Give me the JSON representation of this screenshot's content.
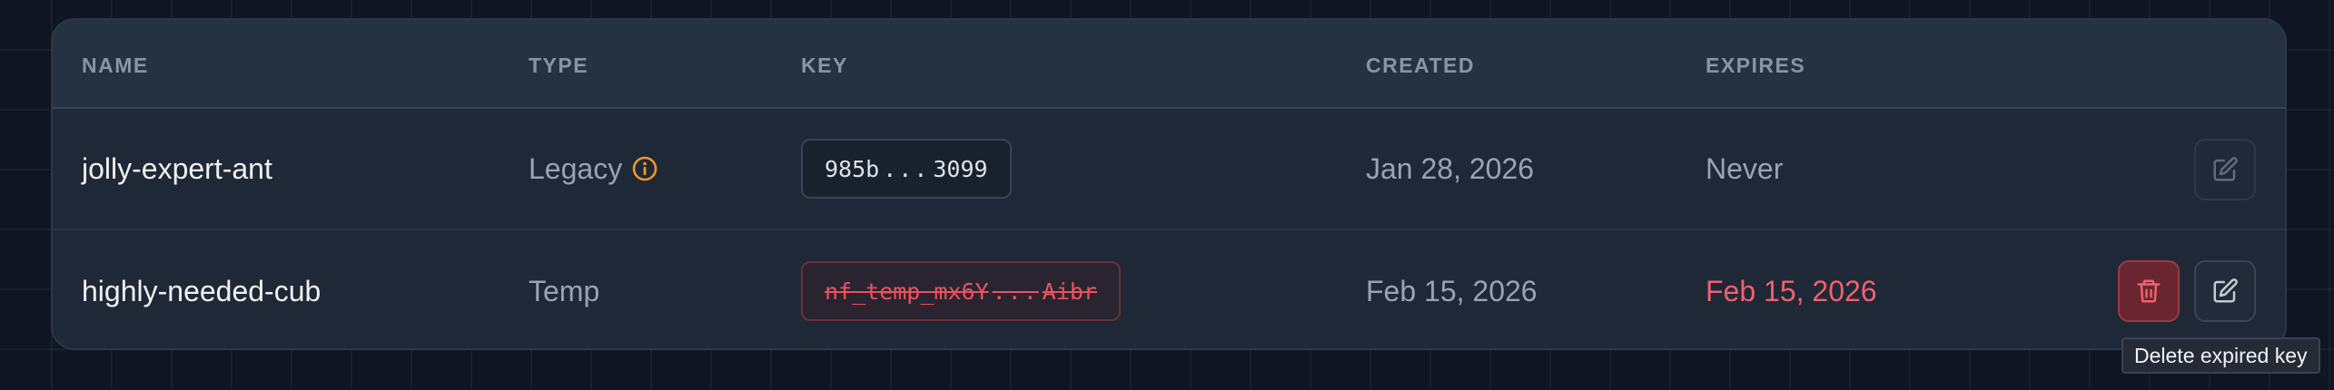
{
  "table": {
    "columns": {
      "name": "NAME",
      "type": "TYPE",
      "key": "KEY",
      "created": "CREATED",
      "expires": "EXPIRES"
    },
    "rows": [
      {
        "name": "jolly-expert-ant",
        "type": "Legacy",
        "type_icon": "info-icon",
        "key_prefix": "985b",
        "key_ellipsis": "...",
        "key_suffix": "3099",
        "created": "Jan 28, 2026",
        "expires": "Never",
        "expired": false,
        "actions": [
          "edit"
        ]
      },
      {
        "name": "highly-needed-cub",
        "type": "Temp",
        "key_prefix": "nf_temp_mx6Y",
        "key_ellipsis": "...",
        "key_suffix": "Aibr",
        "created": "Feb 15, 2026",
        "expires": "Feb 15, 2026",
        "expired": true,
        "actions": [
          "delete",
          "edit"
        ]
      }
    ]
  },
  "tooltip": {
    "text": "Delete expired key"
  },
  "colors": {
    "expired": "#f0616d",
    "warning_icon": "#f0962e"
  },
  "icons": {
    "edit": "pencil-square-icon",
    "delete": "trash-icon"
  }
}
